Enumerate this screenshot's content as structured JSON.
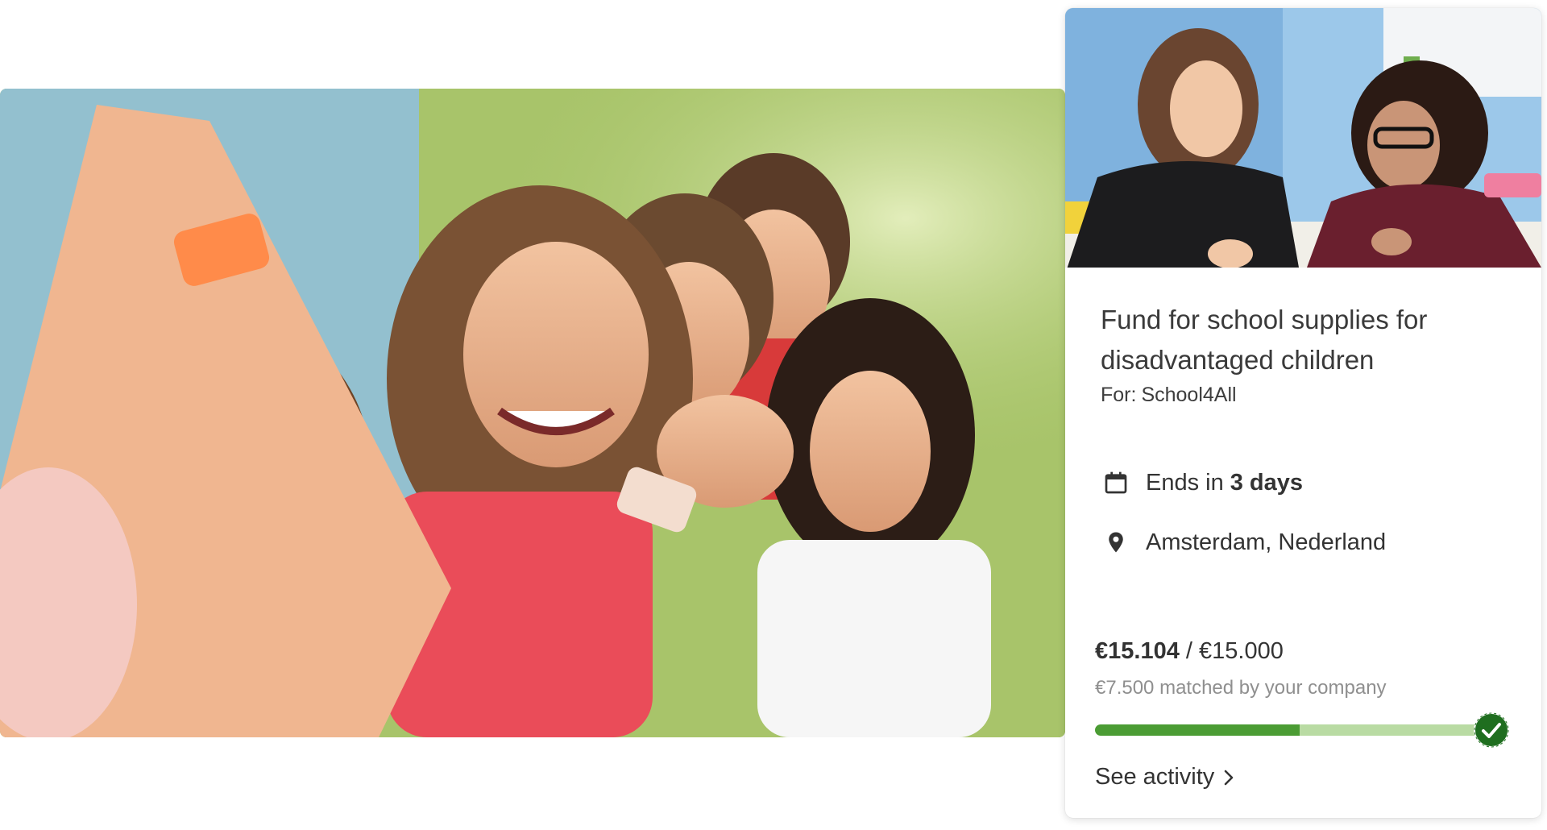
{
  "hero": {
    "image": "children-smiling-outdoors-photo"
  },
  "card": {
    "image": "students-studying-together-photo",
    "title": "Fund for school supplies for disadvantaged children",
    "org_prefix": "For:",
    "org_name": "School4All",
    "ends_prefix": "Ends in",
    "ends_value": "3 days",
    "ends_icon": "calendar-icon",
    "location": "Amsterdam, Nederland",
    "location_icon": "map-pin-icon",
    "raised": "€15.104",
    "separator": "/",
    "goal": "€15.000",
    "matched": "€7.500 matched by your company",
    "progress": {
      "matched_fraction": 0.5,
      "complete": true,
      "complete_icon": "checkmark-icon"
    },
    "see_activity": "See activity",
    "see_activity_icon": "chevron-right-icon"
  },
  "colors": {
    "progress_fill": "#4b9c34",
    "progress_track": "#b9dba3",
    "check_badge": "#1f6e1f",
    "text_primary": "#333333",
    "text_muted": "#8f8f8f"
  }
}
